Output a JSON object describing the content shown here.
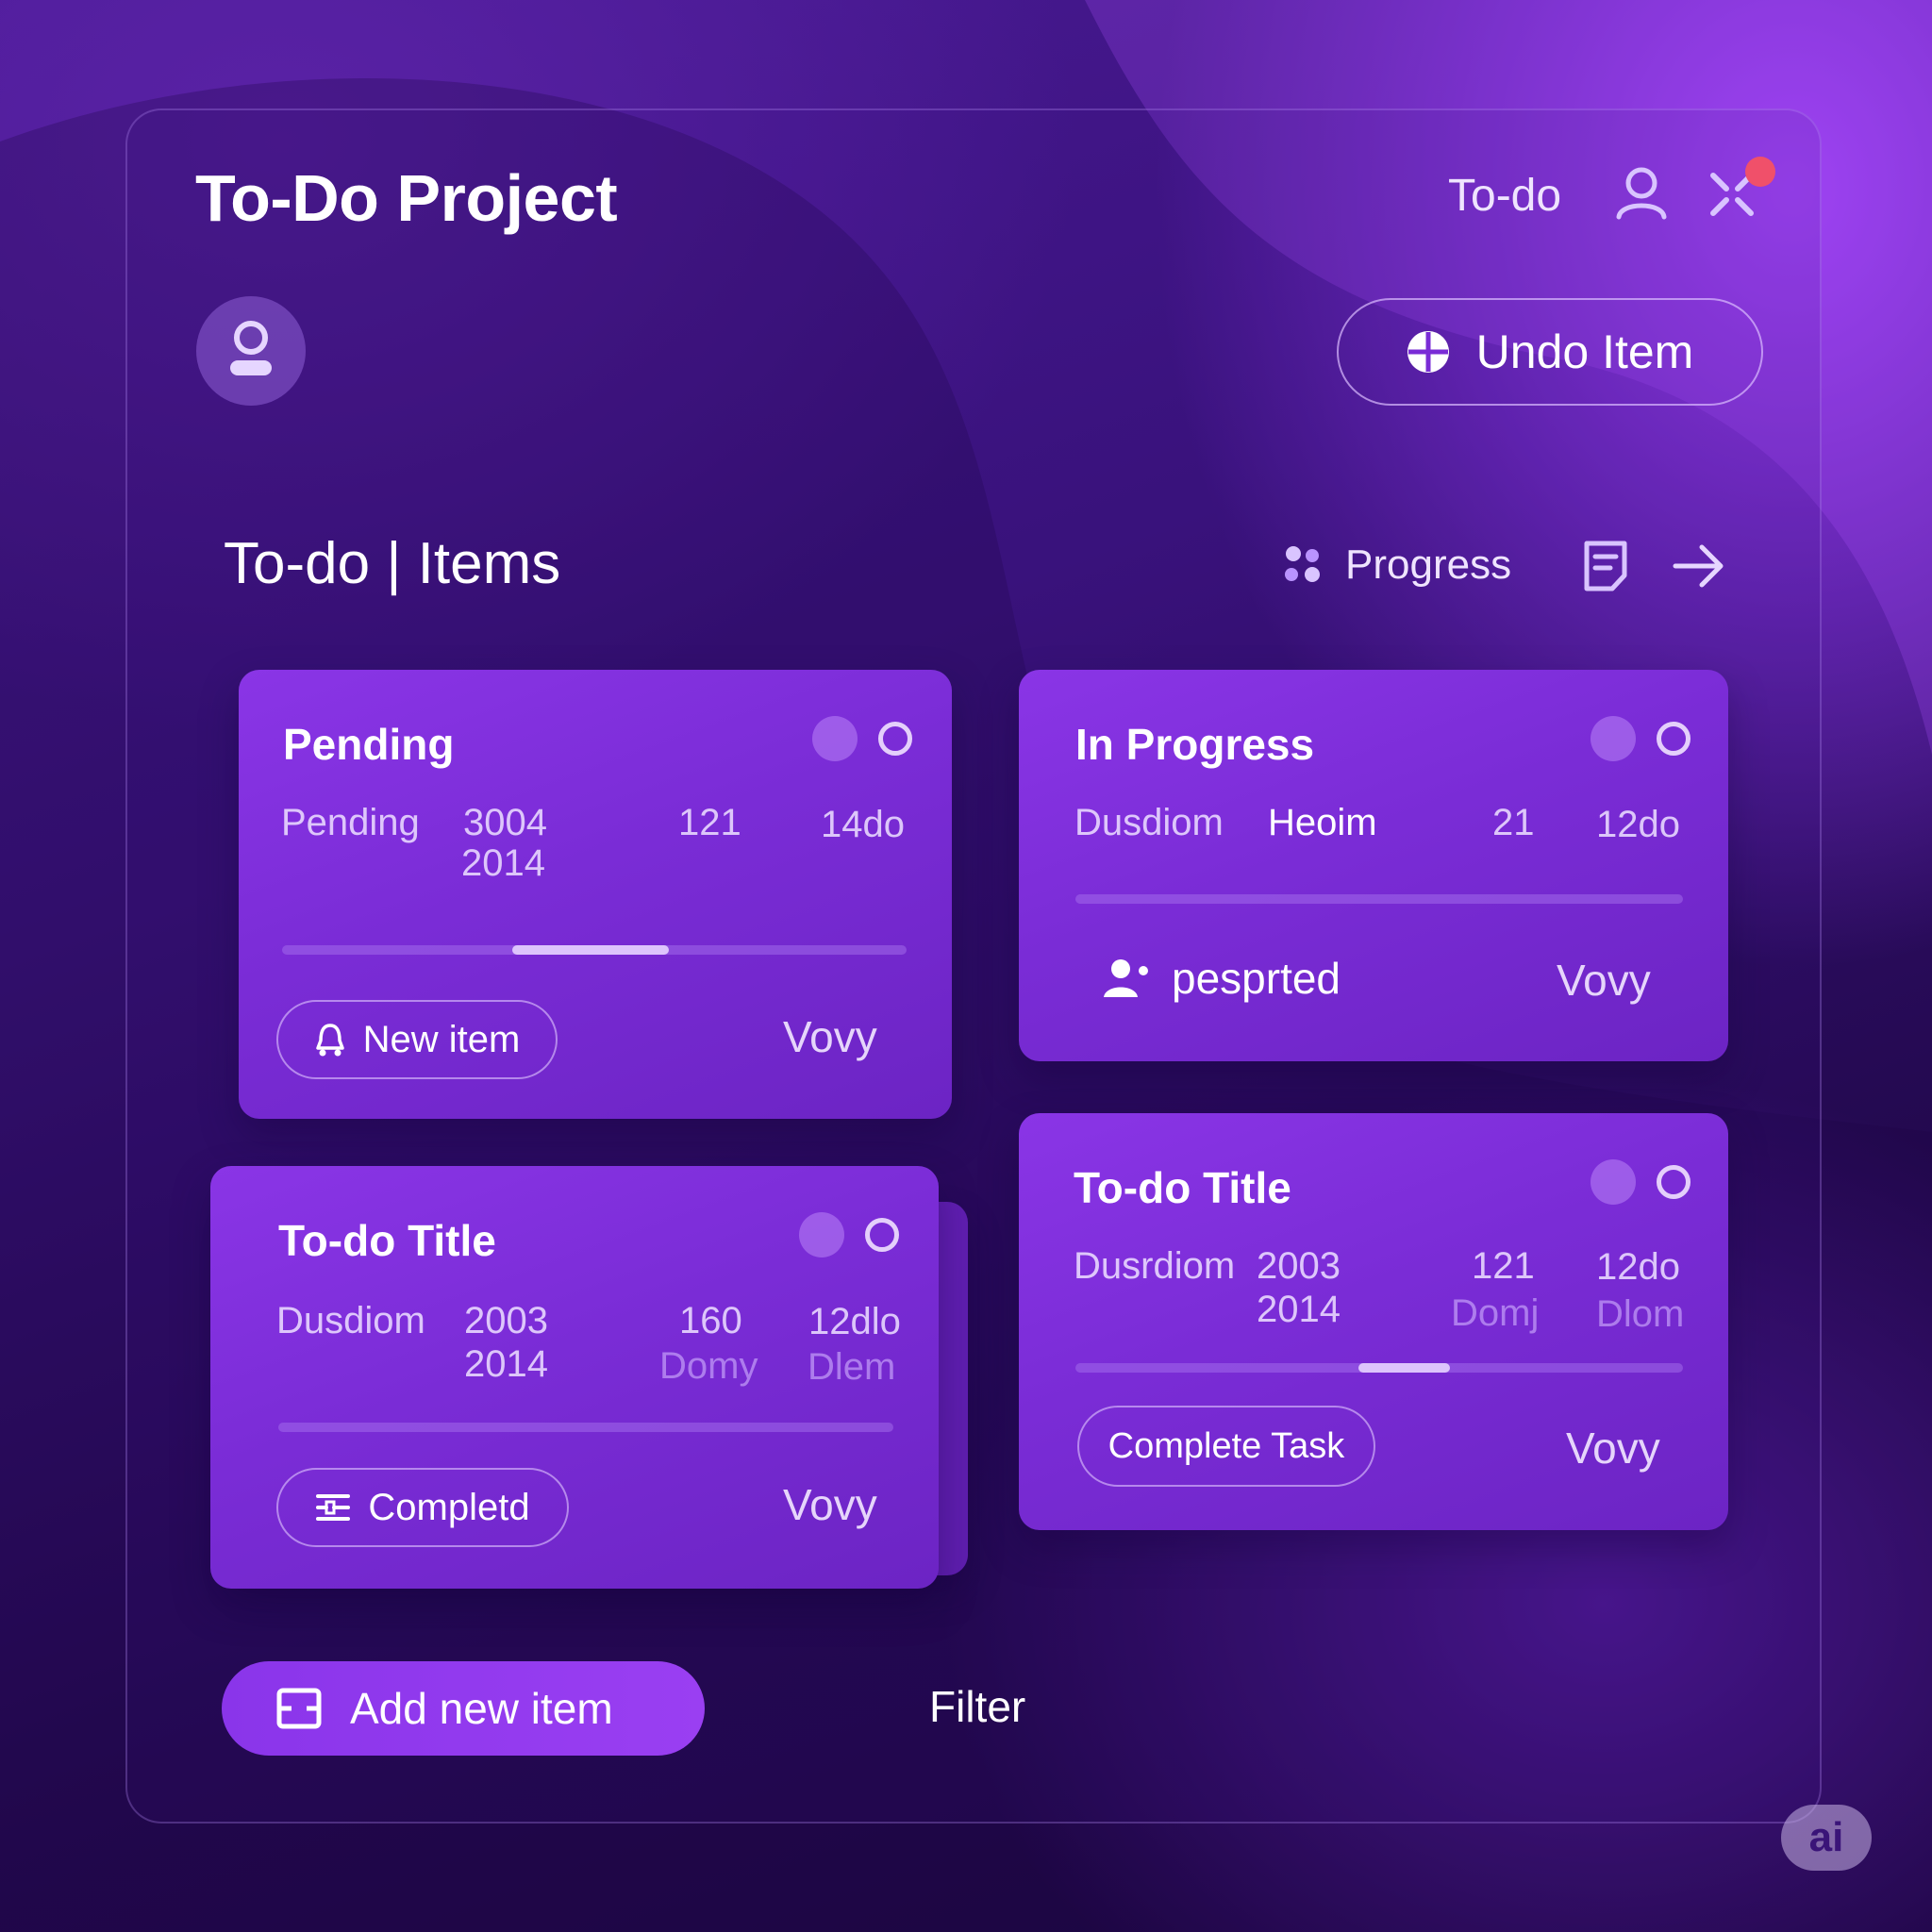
{
  "header": {
    "app_title": "To-Do Project",
    "top_label": "To-do",
    "undo_label": "Undo Item"
  },
  "section": {
    "title": "To-do | Items",
    "progress_label": "Progress"
  },
  "cards": {
    "pending": {
      "title": "Pending",
      "cells": [
        "Pending",
        "3004",
        "2014",
        "121",
        "14do"
      ],
      "progress": 0.25,
      "button_label": "New item",
      "footer_right": "Vovy"
    },
    "in_progress": {
      "title": "In Progress",
      "cells": [
        "Dusdiom",
        "Heoim",
        "21",
        "12do"
      ],
      "progress": 0,
      "assignee": "pesprted",
      "footer_right": "Vovy"
    },
    "todo_left": {
      "title": "To-do Title",
      "cells": [
        "Dusdiom",
        "2003",
        "2014",
        "160",
        "Domy",
        "12dlo",
        "Dlem"
      ],
      "progress": 0,
      "button_label": "Completd",
      "footer_right": "Vovy"
    },
    "todo_right": {
      "title": "To-do Title",
      "cells": [
        "Dusrdiom",
        "2003",
        "2014",
        "121",
        "Domj",
        "12do",
        "Dlom"
      ],
      "progress": 0.15,
      "button_label": "Complete Task",
      "footer_right": "Vovy"
    }
  },
  "footer": {
    "add_label": "Add new item",
    "filter_label": "Filter"
  },
  "badge": {
    "label": "ai"
  },
  "colors": {
    "background": "#2a0d5e",
    "card": "#7a2cd6",
    "accent": "#9a3ff2",
    "notification": "#f0506a"
  },
  "icons": [
    "user-icon",
    "close-icon",
    "avatar-icon",
    "plus-circle-icon",
    "dots-icon",
    "document-icon",
    "arrow-right-icon",
    "face-icon",
    "ring-icon",
    "bell-icon",
    "people-icon",
    "list-icon",
    "inbox-icon"
  ]
}
